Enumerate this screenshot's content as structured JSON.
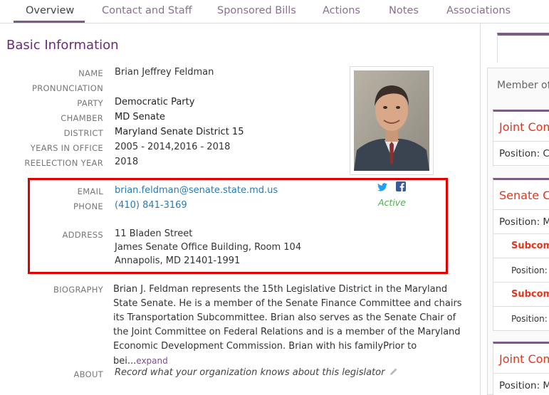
{
  "tabs": [
    {
      "label": "Overview",
      "active": true
    },
    {
      "label": "Contact and Staff"
    },
    {
      "label": "Sponsored Bills"
    },
    {
      "label": "Actions"
    },
    {
      "label": "Notes"
    },
    {
      "label": "Associations"
    }
  ],
  "section_title": "Basic Information",
  "info": {
    "name_label": "NAME",
    "name": "Brian Jeffrey Feldman",
    "pronunciation_label": "PRONUNCIATION",
    "party_label": "PARTY",
    "party": "Democratic Party",
    "chamber_label": "CHAMBER",
    "chamber": "MD Senate",
    "district_label": "DISTRICT",
    "district": "Maryland Senate District 15",
    "years_label": "YEARS IN OFFICE",
    "years": "2005 - 2014,2016 - 2018",
    "reelection_label": "REELECTION YEAR",
    "reelection": "2018"
  },
  "contact": {
    "email_label": "EMAIL",
    "email": "brian.feldman@senate.state.md.us",
    "phone_label": "PHONE",
    "phone": "(410) 841-3169",
    "address_label": "ADDRESS",
    "address_line1": "11 Bladen Street",
    "address_line2": "James Senate Office Building, Room 104",
    "address_line3": "Annapolis, MD 21401-1991",
    "status": "Active"
  },
  "biography": {
    "label": "BIOGRAPHY",
    "text": "Brian J. Feldman represents the 15th Legislative District in the Maryland State Senate. He is a member of the Senate Finance Committee and chairs its Transportation Subcommittee. Brian also serves as the Senate Chair of the Joint Committee on Federal Relations and is a member of the Maryland Economic Development Commission. Brian with his familyPrior to bei...",
    "expand": "expand"
  },
  "about": {
    "label": "ABOUT",
    "placeholder": "Record what your organization knows about this legislator"
  },
  "right_panel": {
    "member_of": "Member of",
    "cards": [
      {
        "title": "Joint Com",
        "rows": [
          {
            "text": "Position: C"
          }
        ]
      },
      {
        "title": "Senate C",
        "rows": [
          {
            "text": "Position: M"
          },
          {
            "text": "Subcom",
            "kind": "subt"
          },
          {
            "text": "Position: M",
            "kind": "sub"
          },
          {
            "text": "Subcom",
            "kind": "subt"
          },
          {
            "text": "Position: M",
            "kind": "sub"
          }
        ]
      },
      {
        "title": "Joint Com",
        "rows": [
          {
            "text": "Position: M"
          }
        ]
      }
    ]
  },
  "colors": {
    "accent": "#7a5c85",
    "title": "#6b2a7a",
    "link": "#2a7ab8",
    "highlight": "#e20000",
    "active": "#4caf50",
    "card_title": "#e8341c"
  },
  "icons": [
    "twitter-icon",
    "facebook-icon",
    "pencil-icon"
  ]
}
